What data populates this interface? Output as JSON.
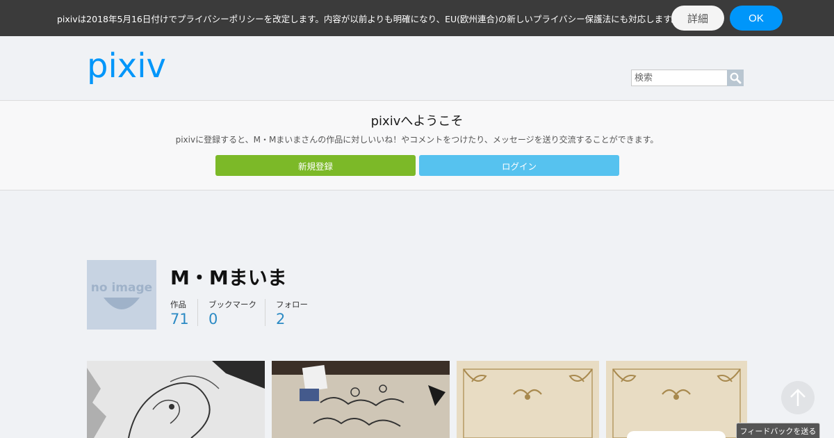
{
  "cookie_bar": {
    "message": "pixivは2018年5月16日付けでプライバシーポリシーを改定します。内容が以前よりも明確になり、EU(欧州連合)の新しいプライバシー保護法にも対応します。",
    "detail_label": "詳細",
    "ok_label": "OK"
  },
  "header": {
    "logo_text": "pixiv",
    "search_placeholder": "検索"
  },
  "welcome": {
    "title": "pixivへようこそ",
    "description": "pixivに登録すると、M・Mまいまさんの作品に対しいいね！やコメントをつけたり、メッセージを送り交流することができます。",
    "register_label": "新規登録",
    "login_label": "ログイン"
  },
  "profile": {
    "avatar_text": "no image",
    "name": "M・Mまいま",
    "stats": [
      {
        "label": "作品",
        "value": "71"
      },
      {
        "label": "ブックマーク",
        "value": "0"
      },
      {
        "label": "フォロー",
        "value": "2"
      }
    ]
  },
  "works": [
    {
      "kind": "sketch-drawing"
    },
    {
      "kind": "sketch-photo"
    },
    {
      "kind": "ornamental-frame"
    },
    {
      "kind": "ornamental-frame"
    }
  ],
  "feedback_label": "フィードバックを送る",
  "colors": {
    "accent": "#0096fa",
    "register": "#7cb928",
    "login": "#56c2ef",
    "stat_value": "#2b8ac4"
  }
}
